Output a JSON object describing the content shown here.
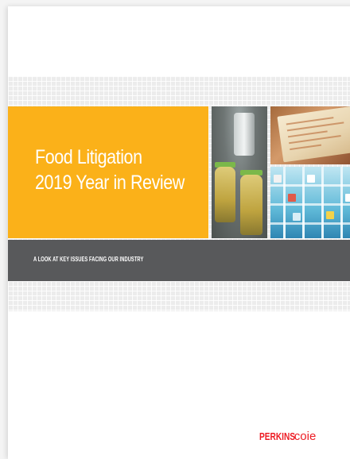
{
  "report": {
    "title_line1": "Food Litigation",
    "title_line2": "2019 Year in Review",
    "tagline": "A LOOK AT KEY ISSUES FACING OUR INDUSTRY"
  },
  "brand": {
    "logo_part1": "PERKINS",
    "logo_part2": "coie",
    "color": "#ed1c24"
  },
  "colors": {
    "title_panel": "#fbb119",
    "tagline_bar": "#58595b",
    "page": "#ffffff"
  },
  "images": [
    "jars-on-production-line-photo",
    "receipt-on-paper-photo",
    "grocery-freezer-aisle-photo"
  ]
}
